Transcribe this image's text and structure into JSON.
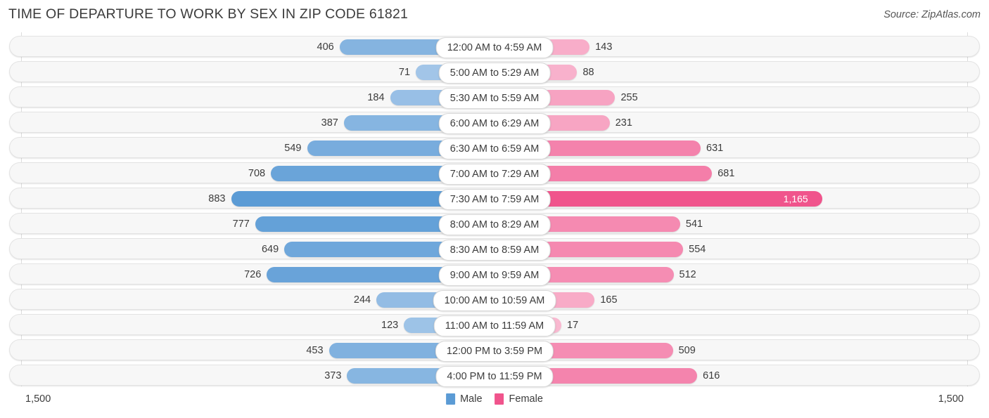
{
  "header": {
    "title": "TIME OF DEPARTURE TO WORK BY SEX IN ZIP CODE 61821",
    "source": "Source: ZipAtlas.com"
  },
  "legend": {
    "male_label": "Male",
    "female_label": "Female",
    "male_color": "#5b9bd5",
    "female_color": "#f0548c"
  },
  "axis": {
    "left_max": "1,500",
    "right_max": "1,500"
  },
  "chart_data": {
    "type": "bar",
    "title": "TIME OF DEPARTURE TO WORK BY SEX IN ZIP CODE 61821",
    "subtitle": "Source: ZipAtlas.com",
    "orientation": "horizontal-diverging",
    "xlabel": "",
    "ylabel": "",
    "xlim": [
      -1500,
      1500
    ],
    "axis_max": 1500,
    "grid": true,
    "legend_position": "bottom-center",
    "categories": [
      "12:00 AM to 4:59 AM",
      "5:00 AM to 5:29 AM",
      "5:30 AM to 5:59 AM",
      "6:00 AM to 6:29 AM",
      "6:30 AM to 6:59 AM",
      "7:00 AM to 7:29 AM",
      "7:30 AM to 7:59 AM",
      "8:00 AM to 8:29 AM",
      "8:30 AM to 8:59 AM",
      "9:00 AM to 9:59 AM",
      "10:00 AM to 10:59 AM",
      "11:00 AM to 11:59 AM",
      "12:00 PM to 3:59 PM",
      "4:00 PM to 11:59 PM"
    ],
    "series": [
      {
        "name": "Male",
        "color": "#5b9bd5",
        "values": [
          406,
          71,
          184,
          387,
          549,
          708,
          883,
          777,
          649,
          726,
          244,
          123,
          453,
          373
        ]
      },
      {
        "name": "Female",
        "color": "#f0548c",
        "values": [
          143,
          88,
          255,
          231,
          631,
          681,
          1165,
          541,
          554,
          512,
          165,
          17,
          509,
          616
        ]
      }
    ]
  },
  "rows": [
    {
      "label": "12:00 AM to 4:59 AM",
      "male": 406,
      "male_text": "406",
      "female": 143,
      "female_text": "143",
      "female_inside": false
    },
    {
      "label": "5:00 AM to 5:29 AM",
      "male": 71,
      "male_text": "71",
      "female": 88,
      "female_text": "88",
      "female_inside": false
    },
    {
      "label": "5:30 AM to 5:59 AM",
      "male": 184,
      "male_text": "184",
      "female": 255,
      "female_text": "255",
      "female_inside": false
    },
    {
      "label": "6:00 AM to 6:29 AM",
      "male": 387,
      "male_text": "387",
      "female": 231,
      "female_text": "231",
      "female_inside": false
    },
    {
      "label": "6:30 AM to 6:59 AM",
      "male": 549,
      "male_text": "549",
      "female": 631,
      "female_text": "631",
      "female_inside": false
    },
    {
      "label": "7:00 AM to 7:29 AM",
      "male": 708,
      "male_text": "708",
      "female": 681,
      "female_text": "681",
      "female_inside": false
    },
    {
      "label": "7:30 AM to 7:59 AM",
      "male": 883,
      "male_text": "883",
      "female": 1165,
      "female_text": "1,165",
      "female_inside": true
    },
    {
      "label": "8:00 AM to 8:29 AM",
      "male": 777,
      "male_text": "777",
      "female": 541,
      "female_text": "541",
      "female_inside": false
    },
    {
      "label": "8:30 AM to 8:59 AM",
      "male": 649,
      "male_text": "649",
      "female": 554,
      "female_text": "554",
      "female_inside": false
    },
    {
      "label": "9:00 AM to 9:59 AM",
      "male": 726,
      "male_text": "726",
      "female": 512,
      "female_text": "512",
      "female_inside": false
    },
    {
      "label": "10:00 AM to 10:59 AM",
      "male": 244,
      "male_text": "244",
      "female": 165,
      "female_text": "165",
      "female_inside": false
    },
    {
      "label": "11:00 AM to 11:59 AM",
      "male": 123,
      "male_text": "123",
      "female": 17,
      "female_text": "17",
      "female_inside": false
    },
    {
      "label": "12:00 PM to 3:59 PM",
      "male": 453,
      "male_text": "453",
      "female": 509,
      "female_text": "509",
      "female_inside": false
    },
    {
      "label": "4:00 PM to 11:59 PM",
      "male": 373,
      "male_text": "373",
      "female": 616,
      "female_text": "616",
      "female_inside": false
    }
  ]
}
